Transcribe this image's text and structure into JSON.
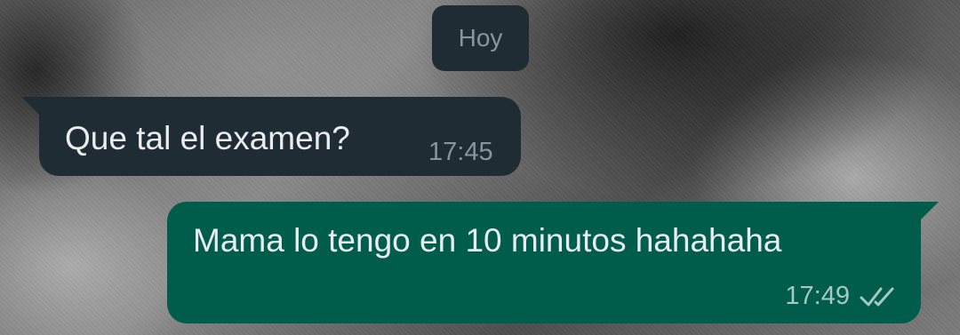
{
  "date_separator": "Hoy",
  "messages": [
    {
      "direction": "incoming",
      "text": "Que tal el examen?",
      "time": "17:45"
    },
    {
      "direction": "outgoing",
      "text": "Mama lo tengo en 10 minutos hahahaha",
      "time": "17:49",
      "status_icon": "double-check-icon"
    }
  ],
  "colors": {
    "incoming_bubble": "#202c33",
    "outgoing_bubble": "#005c4b",
    "date_chip": "#1f2c34",
    "message_text": "#e9edef",
    "meta_text": "#8696a0"
  }
}
